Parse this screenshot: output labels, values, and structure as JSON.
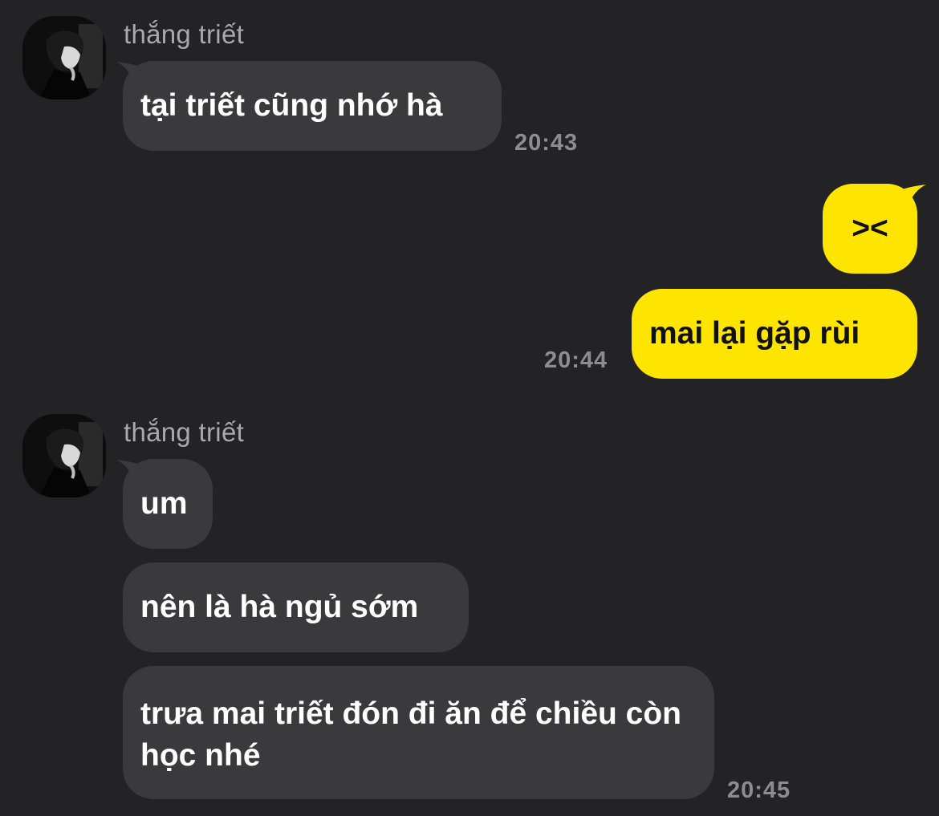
{
  "conversation": {
    "groups": [
      {
        "sender": "thắng triết",
        "messages": [
          "tại triết cũng nhớ hà"
        ],
        "time": "20:43"
      },
      {
        "sender": "me",
        "messages": [
          "><",
          "mai lại gặp rùi"
        ],
        "time": "20:44"
      },
      {
        "sender": "thắng triết",
        "messages": [
          "um",
          "nên là hà ngủ sớm",
          "trưa mai triết đón đi ăn để chiều còn học nhé"
        ],
        "time": "20:45"
      }
    ]
  },
  "colors": {
    "background": "#232325",
    "incoming_bubble": "#3a3a3c",
    "outgoing_bubble": "#fee500",
    "sender_name": "#a9a9ab",
    "timestamp": "#8d8d90"
  },
  "icons": {
    "avatar": "profile-photo"
  }
}
